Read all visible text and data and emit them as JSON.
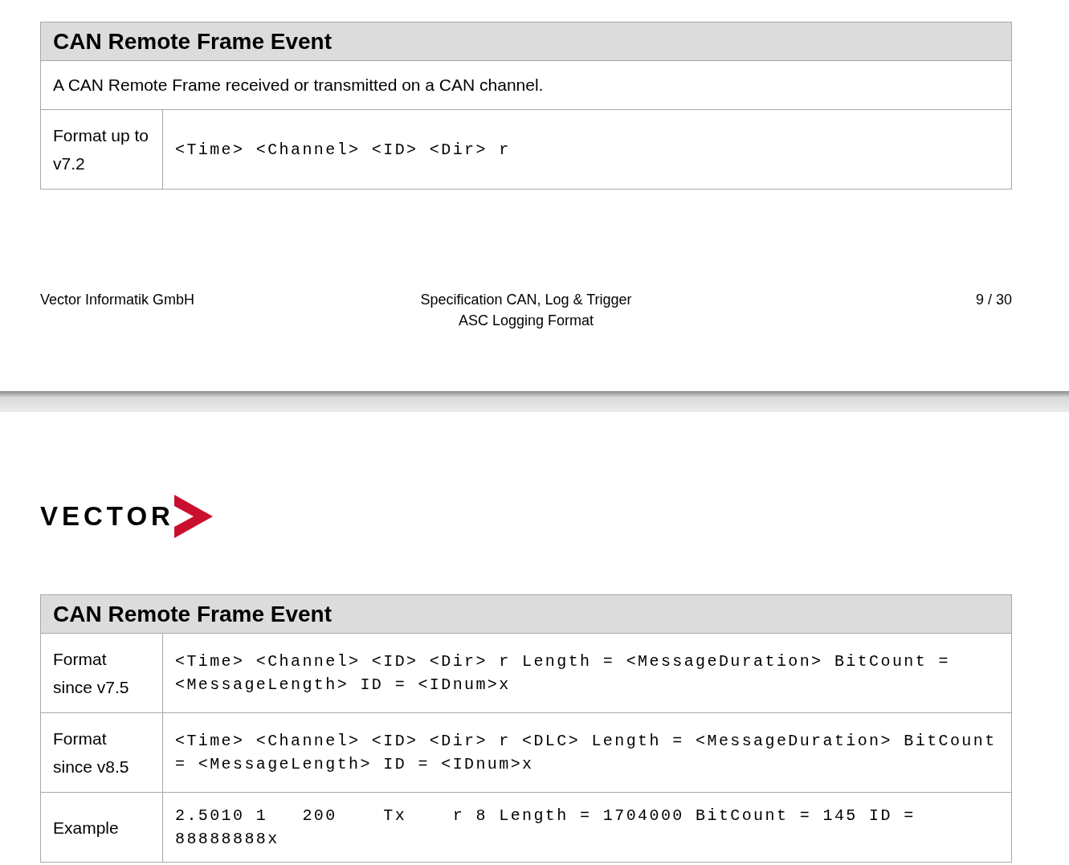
{
  "pages": [
    {
      "table": {
        "title": "CAN Remote Frame Event",
        "rows": [
          {
            "kind": "description",
            "text": "A CAN Remote Frame received or transmitted on a CAN channel."
          },
          {
            "kind": "field",
            "label": "Format up to v7.2",
            "value": "<Time> <Channel> <ID> <Dir> r"
          }
        ]
      },
      "footer": {
        "left": "Vector Informatik GmbH",
        "center": [
          "Specification CAN, Log & Trigger",
          "ASC Logging Format"
        ],
        "right": "9 / 30"
      }
    },
    {
      "logo": "VECTOR",
      "table": {
        "title": "CAN Remote Frame Event",
        "rows": [
          {
            "kind": "field",
            "label": "Format since v7.5",
            "value": "<Time> <Channel> <ID> <Dir> r Length = <MessageDuration> BitCount = <MessageLength> ID = <IDnum>x"
          },
          {
            "kind": "field",
            "label": "Format since v8.5",
            "value": "<Time> <Channel> <ID> <Dir> r <DLC> Length = <MessageDuration> BitCount = <MessageLength> ID = <IDnum>x"
          },
          {
            "kind": "field",
            "label": "Example",
            "value": "2.5010 1   200    Tx    r 8 Length = 1704000 BitCount = 145 ID = 88888888x"
          }
        ]
      }
    }
  ]
}
